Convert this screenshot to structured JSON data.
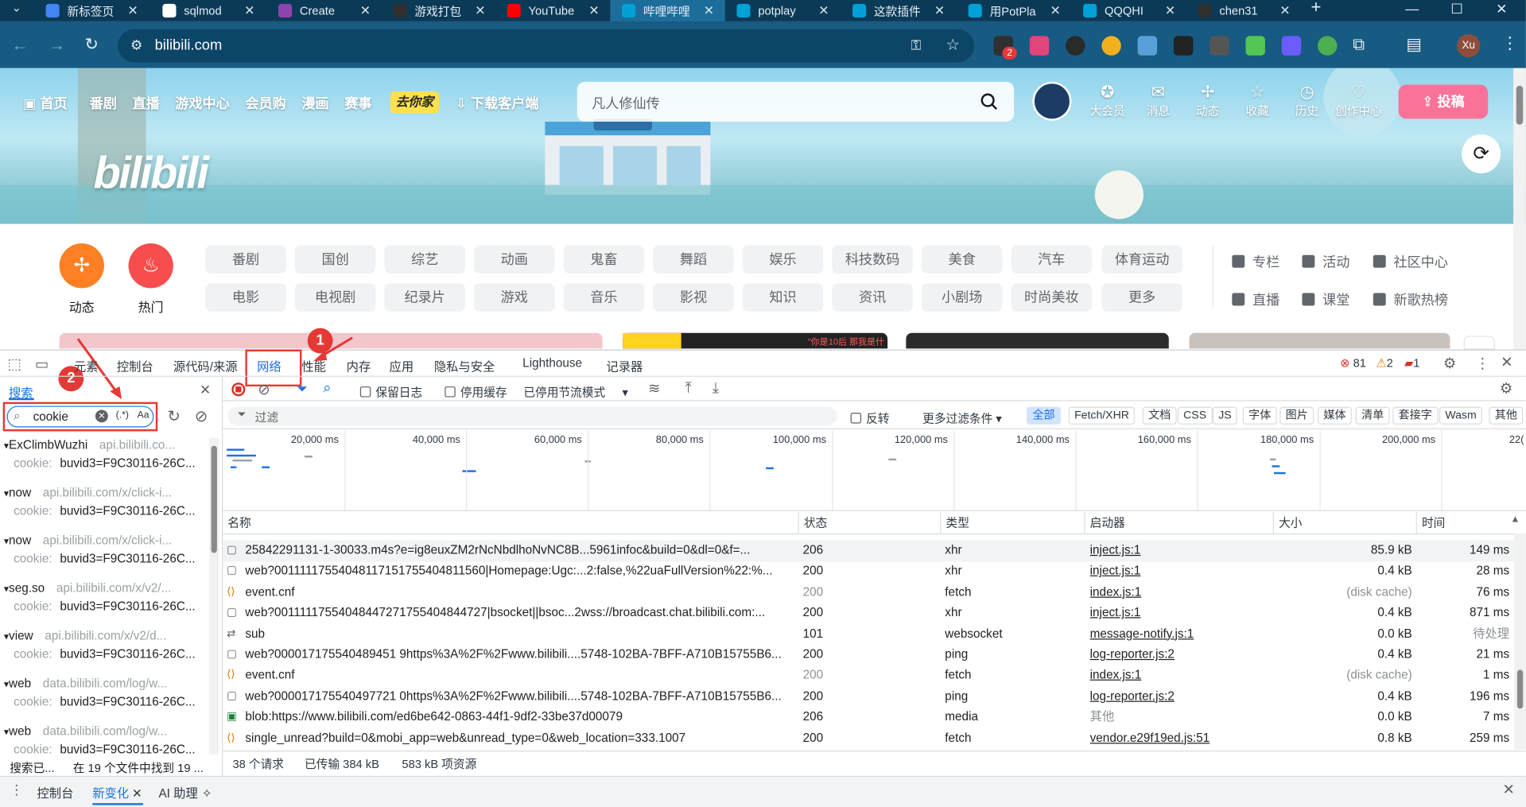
{
  "browser": {
    "tabs": [
      {
        "title": "新标签页",
        "color": "#4285f4"
      },
      {
        "title": "sqlmod",
        "color": "#ffffff"
      },
      {
        "title": "Create",
        "color": "#8e44ad"
      },
      {
        "title": "游戏打包",
        "color": "#303030"
      },
      {
        "title": "YouTube",
        "color": "#ff0000"
      },
      {
        "title": "哔哩哔哩",
        "color": "#00a1d6"
      },
      {
        "title": "potplay",
        "color": "#00a1d6"
      },
      {
        "title": "这款插件",
        "color": "#00a1d6"
      },
      {
        "title": "用PotPla",
        "color": "#00a1d6"
      },
      {
        "title": "QQQHI",
        "color": "#00a1d6"
      },
      {
        "title": "chen31",
        "color": "#303030"
      }
    ],
    "active_tab_index": 5,
    "url": "bilibili.com",
    "profile": "Xu",
    "extension_badge": "2"
  },
  "bili": {
    "nav_left": [
      "首页",
      "番剧",
      "直播",
      "游戏中心",
      "会员购",
      "漫画",
      "赛事"
    ],
    "event_badge": "去你家",
    "download_label": "下载客户端",
    "search_placeholder": "凡人修仙传",
    "nav_right": [
      "大会员",
      "消息",
      "动态",
      "收藏",
      "历史",
      "创作中心"
    ],
    "upload_label": "投稿",
    "logo_text": "bilibili",
    "circle_dynamic": "动态",
    "circle_hot": "热门",
    "categories_row1": [
      "番剧",
      "国创",
      "综艺",
      "动画",
      "鬼畜",
      "舞蹈",
      "娱乐",
      "科技数码",
      "美食",
      "汽车",
      "体育运动"
    ],
    "categories_row2": [
      "电影",
      "电视剧",
      "纪录片",
      "游戏",
      "音乐",
      "影视",
      "知识",
      "资讯",
      "小剧场",
      "时尚美妆",
      "更多"
    ],
    "right_links_row1": [
      "专栏",
      "活动",
      "社区中心"
    ],
    "right_links_row2": [
      "直播",
      "课堂",
      "新歌热榜"
    ],
    "card_caption": "\"你是10后 那我是什么\""
  },
  "devtools": {
    "tabs": [
      "元素",
      "控制台",
      "源代码/来源",
      "网络",
      "性能",
      "内存",
      "应用",
      "隐私与安全",
      "Lighthouse",
      "记录器"
    ],
    "active_tab": "网络",
    "errors": "81",
    "warnings": "2",
    "issues": "1",
    "annotations": [
      "1",
      "2"
    ],
    "search_panel_title": "搜索",
    "search_value": "cookie",
    "search_regex": "(.*)",
    "search_case": "Aa",
    "search_results": [
      {
        "header": "ExClimbWuzhi",
        "url": "api.bilibili.co...",
        "key": "cookie:",
        "value": "buvid3=F9C30116-26C..."
      },
      {
        "header": "now",
        "url": "api.bilibili.com/x/click-i...",
        "key": "cookie:",
        "value": "buvid3=F9C30116-26C..."
      },
      {
        "header": "now",
        "url": "api.bilibili.com/x/click-i...",
        "key": "cookie:",
        "value": "buvid3=F9C30116-26C..."
      },
      {
        "header": "seg.so",
        "url": "api.bilibili.com/x/v2/...",
        "key": "cookie:",
        "value": "buvid3=F9C30116-26C..."
      },
      {
        "header": "view",
        "url": "api.bilibili.com/x/v2/d...",
        "key": "cookie:",
        "value": "buvid3=F9C30116-26C..."
      },
      {
        "header": "web",
        "url": "data.bilibili.com/log/w...",
        "key": "cookie:",
        "value": "buvid3=F9C30116-26C..."
      },
      {
        "header": "web",
        "url": "data.bilibili.com/log/w...",
        "key": "cookie:",
        "value": "buvid3=F9C30116-26C..."
      }
    ],
    "search_status_left": "搜索已...",
    "search_status_right": "在 19 个文件中找到 19 ...",
    "net_toolbar": {
      "preserve_log": "保留日志",
      "disable_cache": "停用缓存",
      "throttle": "已停用节流模式"
    },
    "filter_placeholder": "过滤",
    "invert_label": "反转",
    "more_filters": "更多过滤条件",
    "filter_types": [
      "全部",
      "Fetch/XHR",
      "文档",
      "CSS",
      "JS",
      "字体",
      "图片",
      "媒体",
      "清单",
      "套接字",
      "Wasm",
      "其他"
    ],
    "timeline_ticks": [
      "20,000 ms",
      "40,000 ms",
      "60,000 ms",
      "80,000 ms",
      "100,000 ms",
      "120,000 ms",
      "140,000 ms",
      "160,000 ms",
      "180,000 ms",
      "200,000 ms",
      "22("
    ],
    "columns": [
      "名称",
      "状态",
      "类型",
      "启动器",
      "大小",
      "时间"
    ],
    "requests": [
      {
        "name": "25842291131-1-30033.m4s?e=ig8euxZM2rNcNbdlhoNvNC8B...5961infoc&build=0&dl=0&f=...",
        "status": "206",
        "type": "xhr",
        "initiator": "inject.js:1",
        "size": "85.9 kB",
        "time": "149 ms",
        "icon": "doc"
      },
      {
        "name": "web?00111117554048117151755404811560|Homepage:Ugc:...2:false,%22uaFullVersion%22:%...",
        "status": "200",
        "type": "xhr",
        "initiator": "inject.js:1",
        "size": "0.4 kB",
        "time": "28 ms",
        "icon": "doc"
      },
      {
        "name": "event.cnf",
        "status": "200",
        "type": "fetch",
        "initiator": "index.js:1",
        "size": "(disk cache)",
        "time": "76 ms",
        "icon": "fetch"
      },
      {
        "name": "web?00111117554048447271755404844727|bsocket||bsoc...2wss://broadcast.chat.bilibili.com:...",
        "status": "200",
        "type": "xhr",
        "initiator": "inject.js:1",
        "size": "0.4 kB",
        "time": "871 ms",
        "icon": "doc"
      },
      {
        "name": "sub",
        "status": "101",
        "type": "websocket",
        "initiator": "message-notify.js:1",
        "size": "0.0 kB",
        "time": "待处理",
        "icon": "ws"
      },
      {
        "name": "web?000017175540489451 9https%3A%2F%2Fwww.bilibili....5748-102BA-7BFF-A710B15755B6...",
        "status": "200",
        "type": "ping",
        "initiator": "log-reporter.js:2",
        "size": "0.4 kB",
        "time": "21 ms",
        "icon": "doc"
      },
      {
        "name": "event.cnf",
        "status": "200",
        "type": "fetch",
        "initiator": "index.js:1",
        "size": "(disk cache)",
        "time": "1 ms",
        "icon": "fetch"
      },
      {
        "name": "web?000017175540497721 0https%3A%2F%2Fwww.bilibili....5748-102BA-7BFF-A710B15755B6...",
        "status": "200",
        "type": "ping",
        "initiator": "log-reporter.js:2",
        "size": "0.4 kB",
        "time": "196 ms",
        "icon": "doc"
      },
      {
        "name": "blob:https://www.bilibili.com/ed6be642-0863-44f1-9df2-33be37d00079",
        "status": "206",
        "type": "media",
        "initiator": "其他",
        "size": "0.0 kB",
        "time": "7 ms",
        "icon": "media"
      },
      {
        "name": "single_unread?build=0&mobi_app=web&unread_type=0&web_location=333.1007",
        "status": "200",
        "type": "fetch",
        "initiator": "vendor.e29f19ed.js:51",
        "size": "0.8 kB",
        "time": "259 ms",
        "icon": "fetch"
      }
    ],
    "status_bar": [
      "38 个请求",
      "已传输 384 kB",
      "583 kB 项资源"
    ],
    "drawer_tabs": [
      "控制台",
      "新变化",
      "AI 助理"
    ],
    "drawer_active": "新变化"
  }
}
